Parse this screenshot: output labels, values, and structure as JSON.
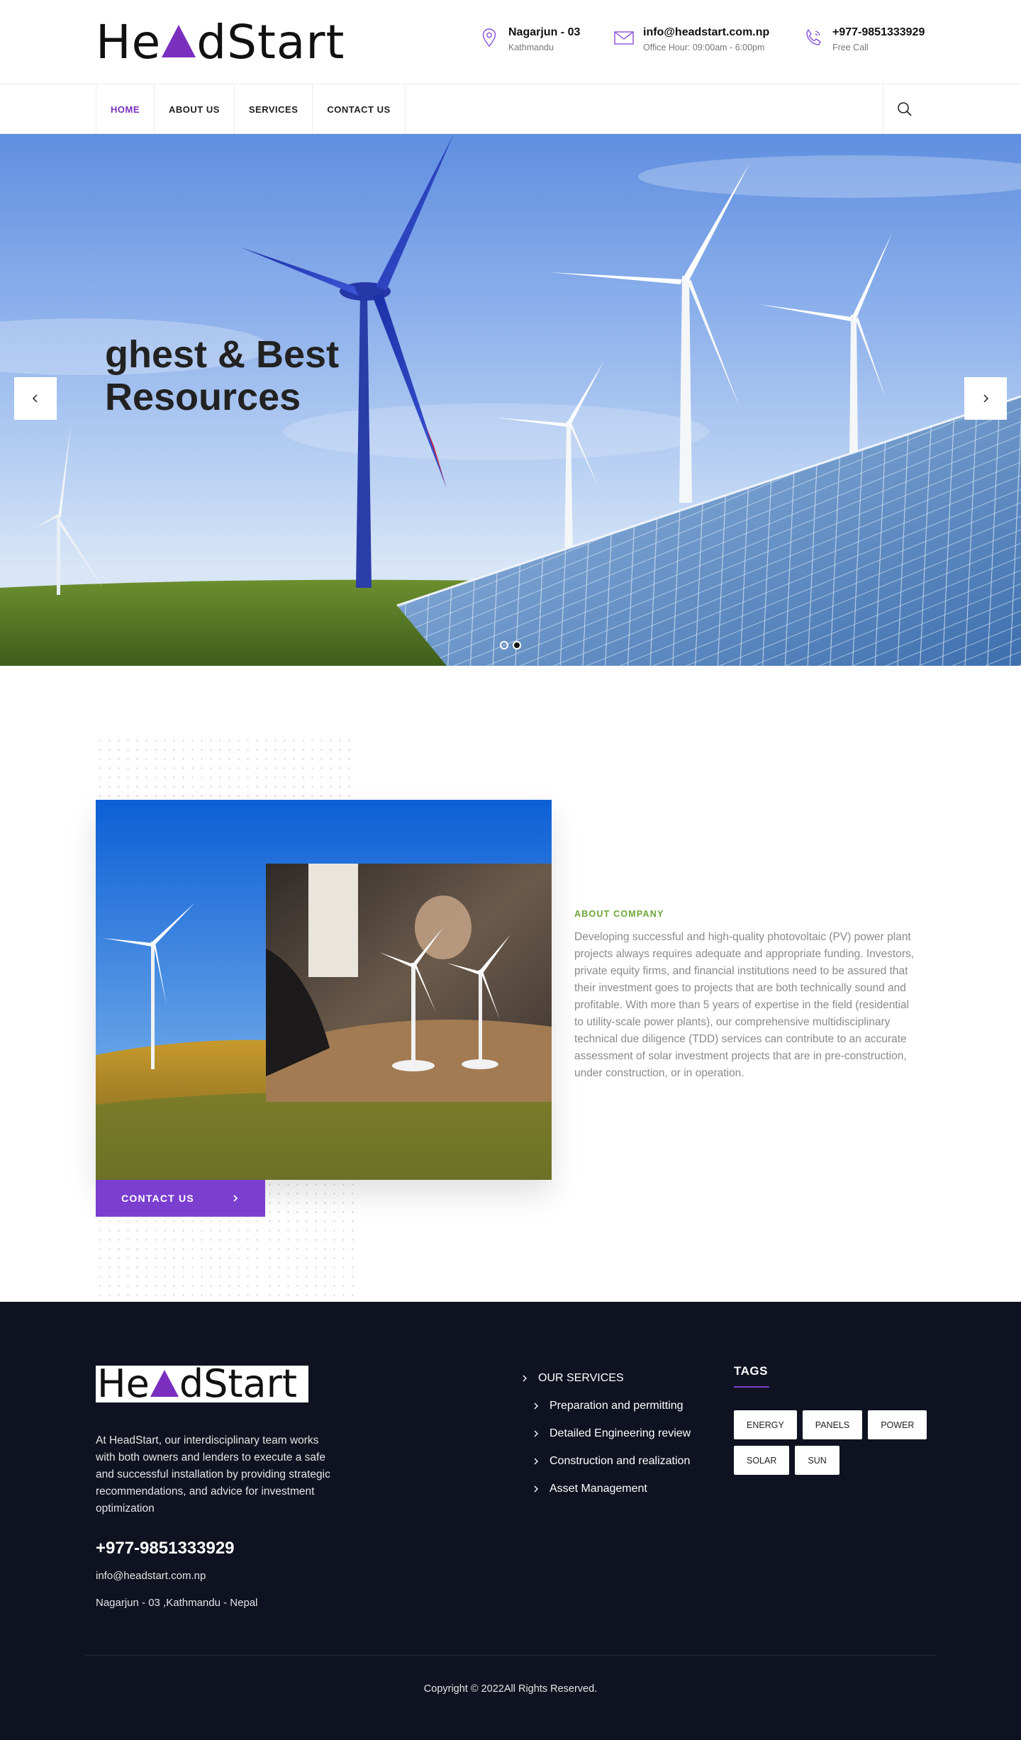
{
  "header": {
    "logo": "HeadStart",
    "contacts": [
      {
        "icon": "map-pin-icon",
        "title": "Nagarjun - 03",
        "subtitle": "Kathmandu"
      },
      {
        "icon": "envelope-icon",
        "title": "info@headstart.com.np",
        "subtitle": "Office Hour: 09:00am - 6:00pm"
      },
      {
        "icon": "phone-icon",
        "title": "+977-9851333929",
        "subtitle": "Free Call"
      }
    ]
  },
  "nav": {
    "items": [
      "HOME",
      "ABOUT US",
      "SERVICES",
      "CONTACT US"
    ],
    "active": "HOME",
    "search_icon": "search-icon"
  },
  "hero": {
    "title_line1": "ghest & Best",
    "title_line2": "Resources",
    "prev_icon": "chevron-left-icon",
    "next_icon": "chevron-right-icon",
    "slides": 2,
    "active_slide": 2
  },
  "about": {
    "label": "ABOUT COMPANY",
    "text": "Developing successful and high-quality photovoltaic (PV) power plant projects always requires adequate and appropriate funding. Investors, private equity firms, and financial institutions need to be assured that their investment goes to projects that are both technically sound and profitable. With more than 5 years of expertise in the field (residential to utility-scale power plants), our comprehensive multidisciplinary technical due diligence (TDD) services can contribute to an accurate assessment of solar investment projects that are in pre-construction, under construction, or in operation.",
    "cta": "CONTACT US"
  },
  "footer": {
    "logo": "HeadStart",
    "about": "At HeadStart, our interdisciplinary team works with both owners and lenders to execute a safe and successful installation by providing strategic recommendations, and advice for investment optimization",
    "phone": "+977-9851333929",
    "email": "info@headstart.com.np",
    "address": "Nagarjun - 03 ,Kathmandu - Nepal",
    "services_heading": "OUR SERVICES",
    "services": [
      "Preparation and permitting",
      "Detailed Engineering review",
      "Construction and realization",
      "Asset Management"
    ],
    "tags_heading": "TAGS",
    "tags": [
      "ENERGY",
      "PANELS",
      "POWER",
      "SOLAR",
      "SUN"
    ],
    "copyright": "Copyright © 2022All Rights Reserved."
  },
  "colors": {
    "brand": "#7b2fbe",
    "cta": "#7b3fd0",
    "accent_green": "#6aa637",
    "footer_bg": "#0f1220"
  }
}
